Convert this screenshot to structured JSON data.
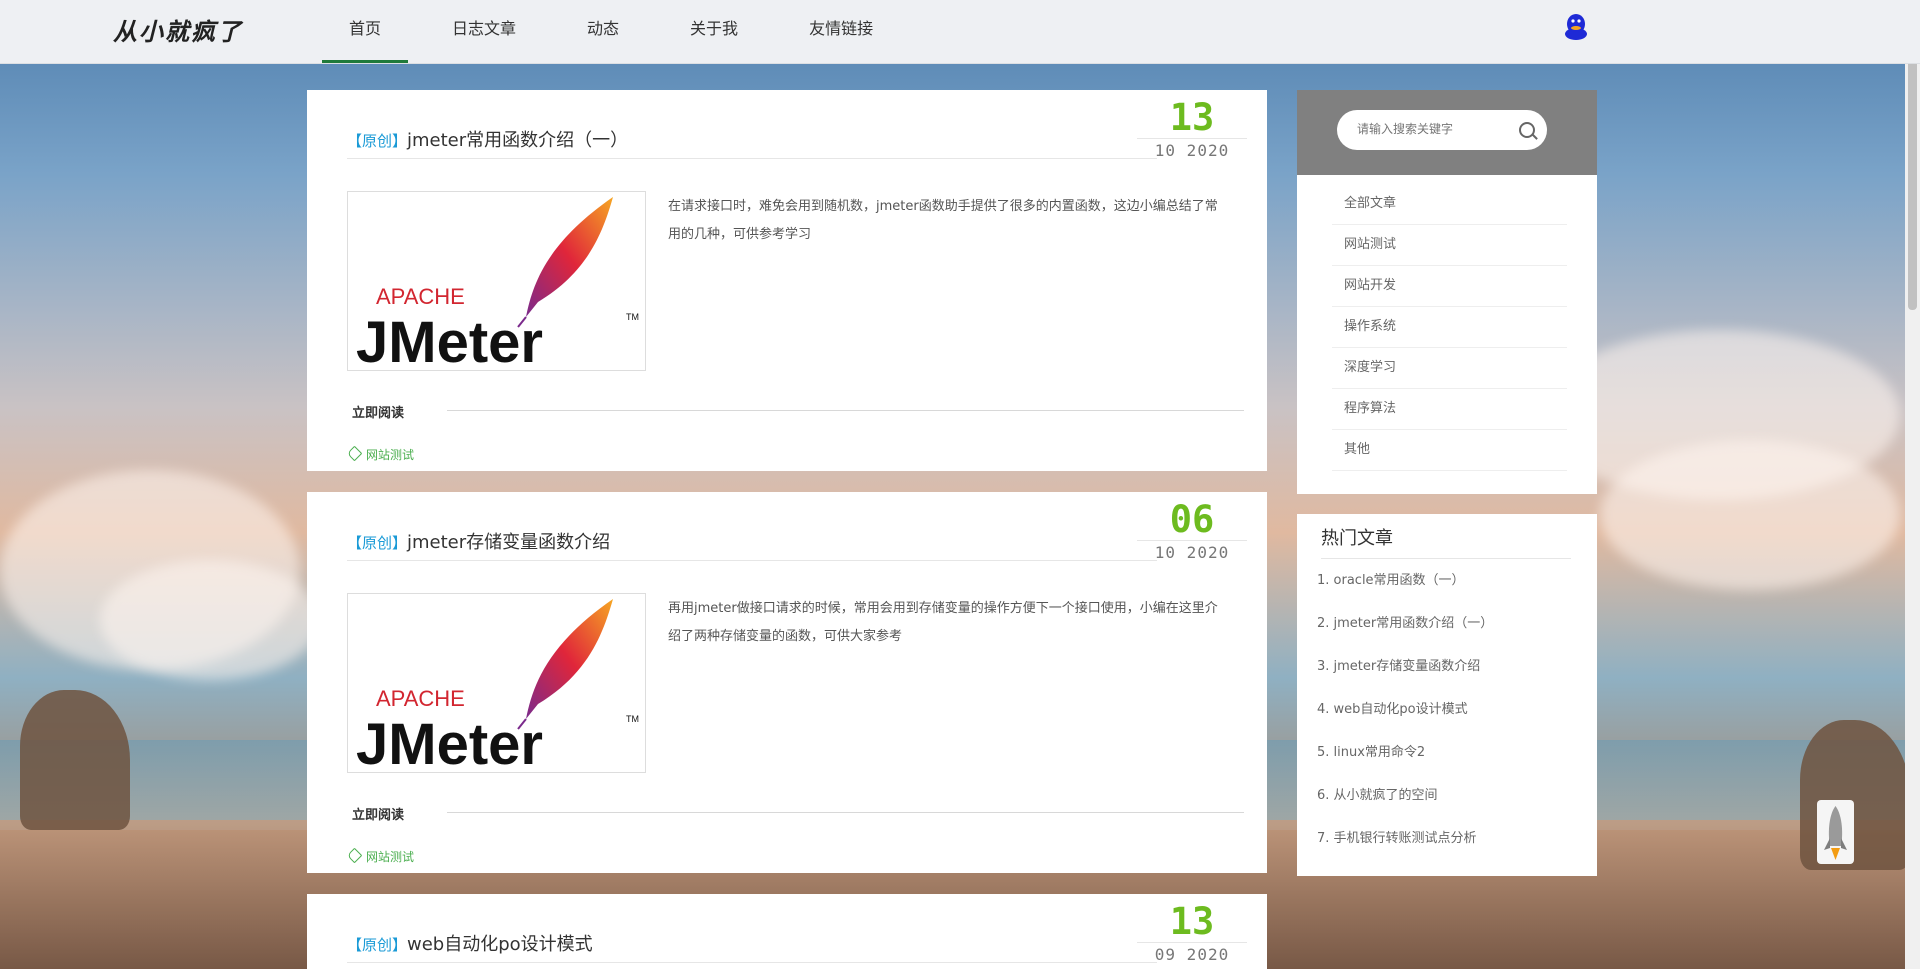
{
  "site": {
    "logo": "从小就疯了"
  },
  "nav": {
    "items": [
      "首页",
      "日志文章",
      "动态",
      "关于我",
      "友情链接"
    ],
    "active": 0
  },
  "articles": [
    {
      "tag": "【原创】",
      "title": "jmeter常用函数介绍（一）",
      "day": "13",
      "month_year": "10 2020",
      "excerpt": "在请求接口时，难免会用到随机数，jmeter函数助手提供了很多的内置函数，这边小编总结了常用的几种，可供参考学习",
      "read_more": "立即阅读",
      "category": "网站测试",
      "thumb_logo": {
        "apache": "APACHE",
        "name": "JMeter",
        "tm": "TM"
      }
    },
    {
      "tag": "【原创】",
      "title": "jmeter存储变量函数介绍",
      "day": "06",
      "month_year": "10 2020",
      "excerpt": "再用jmeter做接口请求的时候，常用会用到存储变量的操作方便下一个接口使用，小编在这里介绍了两种存储变量的函数，可供大家参考",
      "read_more": "立即阅读",
      "category": "网站测试",
      "thumb_logo": {
        "apache": "APACHE",
        "name": "JMeter",
        "tm": "TM"
      }
    },
    {
      "tag": "【原创】",
      "title": "web自动化po设计模式",
      "day": "13",
      "month_year": "09 2020"
    }
  ],
  "sidebar": {
    "search_placeholder": "请输入搜索关键字",
    "categories": [
      "全部文章",
      "网站测试",
      "网站开发",
      "操作系统",
      "深度学习",
      "程序算法",
      "其他"
    ],
    "hot_title": "热门文章",
    "hot_articles": [
      "1. oracle常用函数（一）",
      "2. jmeter常用函数介绍（一）",
      "3. jmeter存储变量函数介绍",
      "4. web自动化po设计模式",
      "5. linux常用命令2",
      "6. 从小就疯了的空间",
      "7. 手机银行转账测试点分析"
    ]
  },
  "colors": {
    "accent_green": "#6dbb1f",
    "tag_blue": "#1a9ad6",
    "nav_active": "#1f7a3a"
  },
  "icons": {
    "header_right": "qq-penguin-icon",
    "category": "tag-icon",
    "search": "search-icon",
    "back_to_top": "rocket-icon"
  }
}
